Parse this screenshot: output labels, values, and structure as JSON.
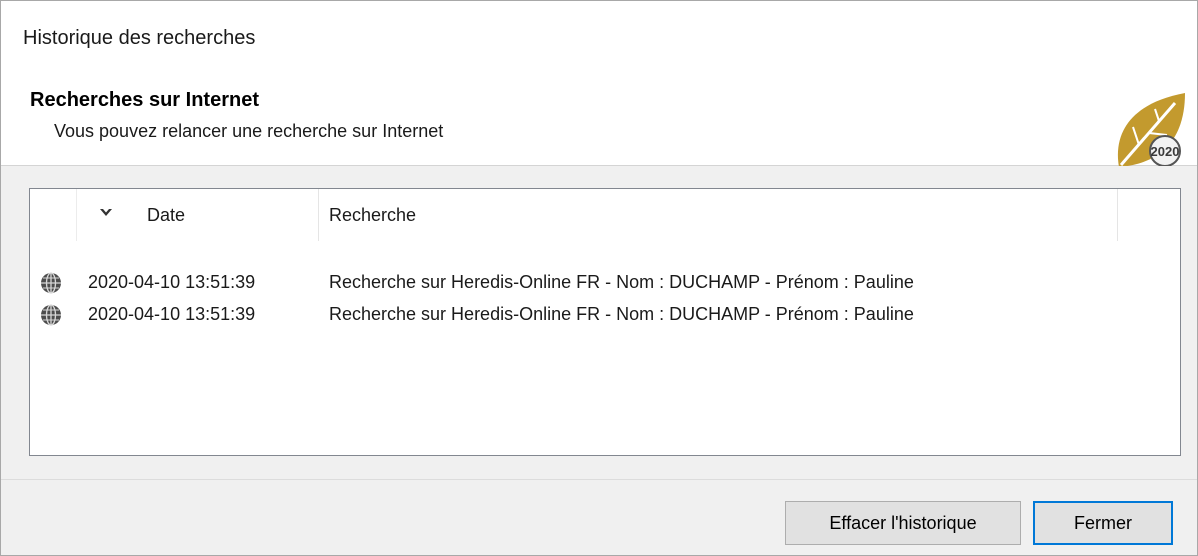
{
  "window": {
    "title": "Historique des recherches"
  },
  "header": {
    "title": "Recherches sur Internet",
    "subtitle": "Vous pouvez relancer une recherche sur Internet",
    "logo_text": "2020"
  },
  "list": {
    "columns": {
      "date": "Date",
      "search": "Recherche"
    },
    "sort_icon": "chevron-down-icon",
    "row_icon": "globe-icon",
    "rows": [
      {
        "date": "2020-04-10 13:51:39",
        "search": "Recherche sur Heredis-Online FR - Nom : DUCHAMP - Prénom : Pauline"
      },
      {
        "date": "2020-04-10 13:51:39",
        "search": "Recherche sur Heredis-Online FR - Nom : DUCHAMP - Prénom : Pauline"
      }
    ]
  },
  "buttons": {
    "clear_label": "Effacer l'historique",
    "close_label": "Fermer"
  },
  "colors": {
    "accent": "#0078d7",
    "logo_gold": "#c39a2e"
  }
}
